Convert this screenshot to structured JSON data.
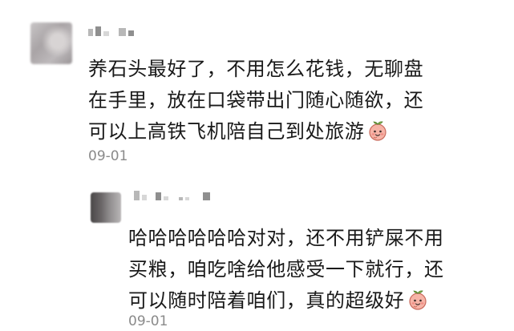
{
  "comments": [
    {
      "lines": [
        "养石头最好了，不用怎么花钱，无聊盘",
        "在手里，放在口袋带出门随心随欲，还",
        "可以上高铁飞机陪自己到处旅游"
      ],
      "emoji": "peach-emoji-icon",
      "time": "09-01"
    },
    {
      "lines": [
        "哈哈哈哈哈哈对对，还不用铲屎不用",
        "买粮，咱吃啥给他感受一下就行，还",
        "可以随时陪着咱们，真的超级好"
      ],
      "emoji": "peach-emoji-icon",
      "time": "09-01"
    }
  ],
  "colors": {
    "text": "#191919",
    "time": "#8a8a8a",
    "emoji_fill": "#f4a79a"
  }
}
